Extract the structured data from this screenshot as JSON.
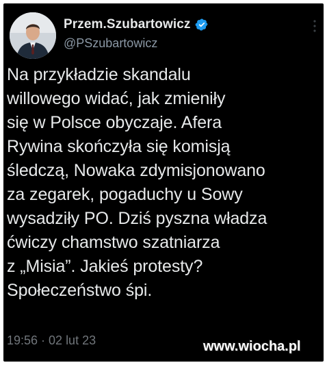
{
  "tweet": {
    "author": {
      "display_name": "Przem.Szubartowicz",
      "handle": "@PSzubartowicz",
      "verified": true,
      "avatar_icon": "person-avatar-icon"
    },
    "text_lines": [
      "Na przykładzie skandalu",
      "willowego widać, jak zmieniły",
      "się w Polsce obyczaje. Afera",
      "Rywina skończyła się komisją",
      "śledczą, Nowaka zdymisjonowano",
      "za zegarek, pogaduchy u Sowy",
      "wysadziły PO. Dziś pyszna władza",
      "ćwiczy chamstwo szatniarza",
      "z „Misia”. Jakieś protesty?",
      "Społeczeństwo śpi."
    ],
    "timestamp": "19:56 · 02 lut 23"
  },
  "watermark": "www.wiocha.pl",
  "colors": {
    "background": "#000000",
    "text": "#e7e9ea",
    "secondary_text": "#8b98a5",
    "verified_badge": "#1d9bf0"
  },
  "icons": {
    "verified": "verified-badge-icon",
    "more": "more-options-icon"
  }
}
